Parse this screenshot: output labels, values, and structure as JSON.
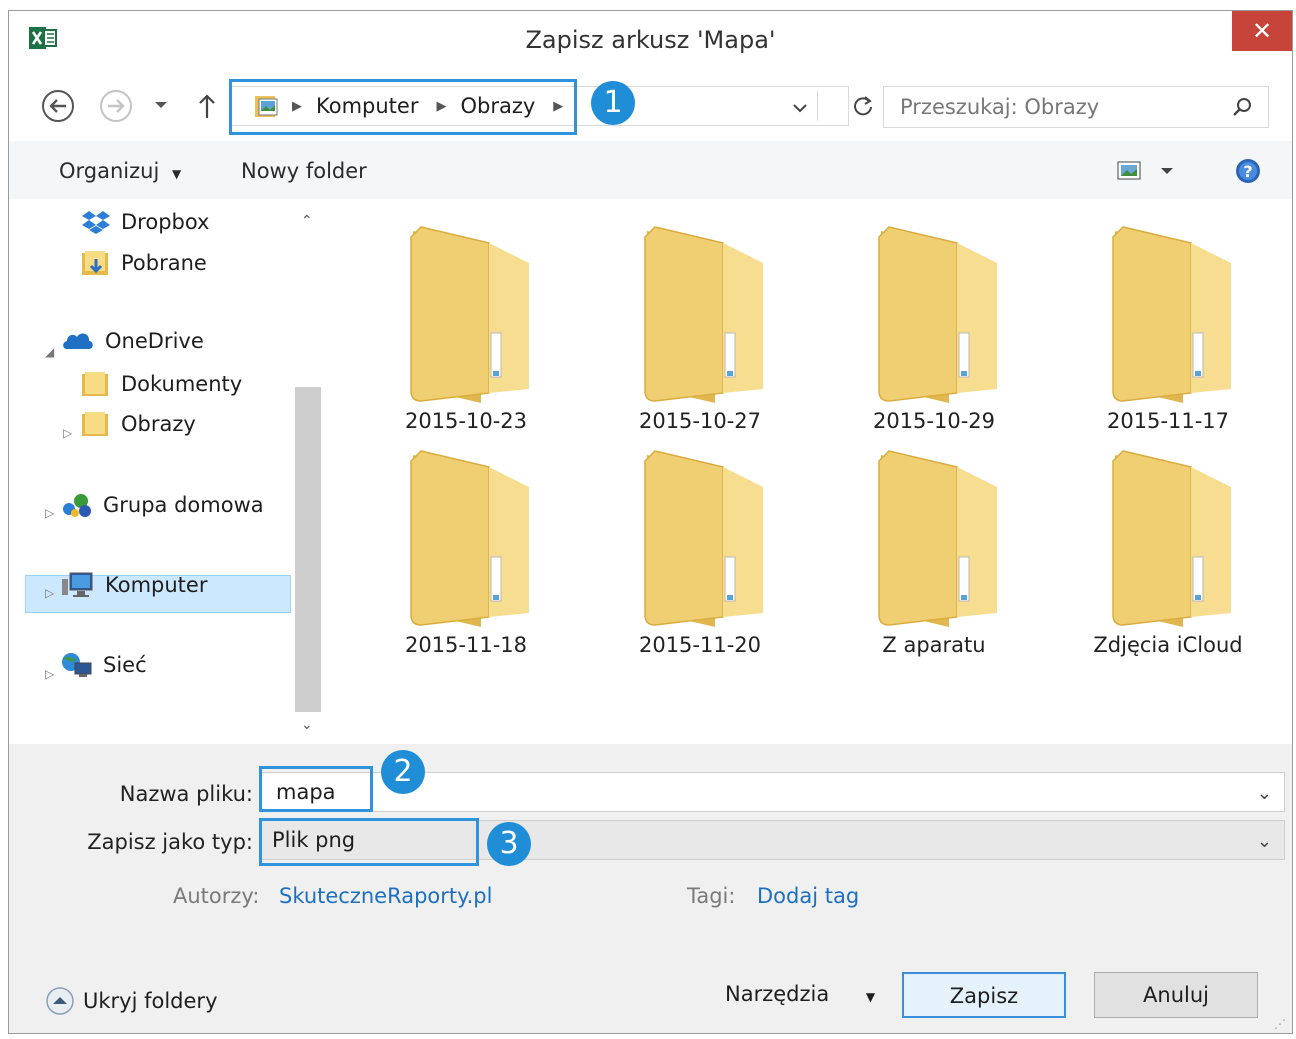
{
  "window": {
    "title": "Zapisz arkusz 'Mapa'",
    "close_glyph": "✕"
  },
  "nav": {
    "breadcrumb": [
      "Komputer",
      "Obrazy"
    ],
    "search_placeholder": "Przeszukaj: Obrazy"
  },
  "callouts": [
    "1",
    "2",
    "3"
  ],
  "toolbar": {
    "organize": "Organizuj",
    "new_folder": "Nowy folder"
  },
  "sidebar": {
    "items": [
      {
        "label": "Dropbox",
        "icon": "dropbox-icon"
      },
      {
        "label": "Pobrane",
        "icon": "downloads-folder-icon"
      },
      {
        "label": "OneDrive",
        "icon": "onedrive-icon"
      },
      {
        "label": "Dokumenty",
        "icon": "folder-icon"
      },
      {
        "label": "Obrazy",
        "icon": "folder-icon"
      },
      {
        "label": "Grupa domowa",
        "icon": "homegroup-icon"
      },
      {
        "label": "Komputer",
        "icon": "computer-icon",
        "selected": true
      },
      {
        "label": "Sieć",
        "icon": "network-icon"
      }
    ]
  },
  "folders": [
    "2015-10-23",
    "2015-10-27",
    "2015-10-29",
    "2015-11-17",
    "2015-11-18",
    "2015-11-20",
    "Z aparatu",
    "Zdjęcia iCloud"
  ],
  "form": {
    "filename_label": "Nazwa pliku:",
    "filename_value": "mapa",
    "filetype_label": "Zapisz jako typ:",
    "filetype_value": "Plik png",
    "authors_label": "Autorzy:",
    "authors_value": "SkuteczneRaporty.pl",
    "tags_label": "Tagi:",
    "tags_value": "Dodaj tag"
  },
  "footer": {
    "hide_folders": "Ukryj foldery",
    "tools": "Narzędzia",
    "save": "Zapisz",
    "cancel": "Anuluj"
  },
  "colors": {
    "accent": "#2f93dd",
    "callout": "#1f8ed6",
    "link": "#1c6fc1",
    "close": "#c7443a",
    "selection": "#cce8ff"
  }
}
